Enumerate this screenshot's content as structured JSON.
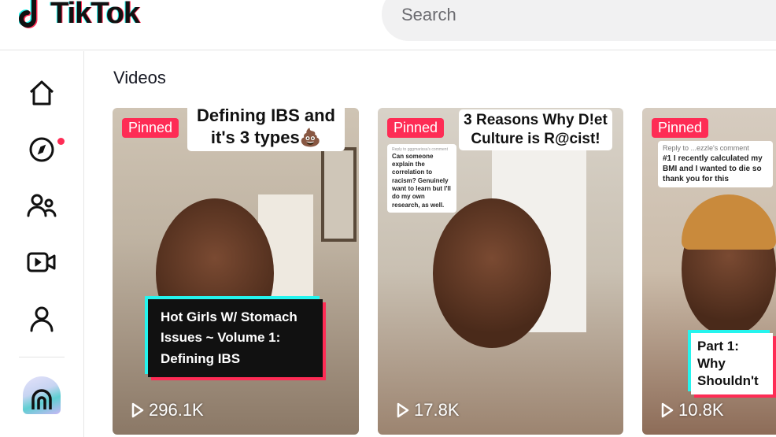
{
  "header": {
    "logo_text": "TikTok",
    "search_placeholder": "Search"
  },
  "sidebar": {
    "items": [
      {
        "icon": "home-icon"
      },
      {
        "icon": "compass-icon",
        "notification": true
      },
      {
        "icon": "friends-icon"
      },
      {
        "icon": "live-video-icon"
      },
      {
        "icon": "profile-icon"
      }
    ],
    "app_icon": "arch-app-icon"
  },
  "main": {
    "title": "Videos",
    "videos": [
      {
        "badge": "Pinned",
        "caption": "Defining IBS and it's 3 types💩",
        "overlay": "Hot Girls W/ Stomach Issues ~ Volume 1: Defining IBS",
        "views": "296.1K"
      },
      {
        "badge": "Pinned",
        "caption": "3 Reasons Why D!et Culture is R@cist!",
        "comment_header": "Reply to gggmarissa's comment",
        "comment": "Can someone explain the correlation to racism? Genuinely want to learn but I'll do my own research, as well.",
        "views": "17.8K"
      },
      {
        "badge": "Pinned",
        "comment_header": "Reply to ...ezzle's comment",
        "comment": "#1 I recently calculated my BMI and I wanted to die so thank you for this",
        "overlay": "Part 1: Why Shouldn't",
        "views": "10.8K"
      }
    ]
  },
  "colors": {
    "accent": "#fe2c55",
    "cyan": "#25f4ee"
  }
}
